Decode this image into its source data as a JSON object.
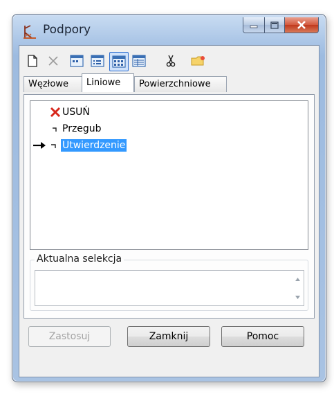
{
  "window": {
    "title": "Podpory",
    "icon": "supports-app-icon",
    "caption_buttons": [
      "minimize",
      "maximize",
      "close"
    ]
  },
  "toolbar": {
    "buttons": [
      {
        "icon": "new-file-icon"
      },
      {
        "icon": "delete-icon"
      },
      {
        "icon": "view-small-icons-icon"
      },
      {
        "icon": "view-list-icon"
      },
      {
        "icon": "view-large-icons-icon",
        "pressed": true
      },
      {
        "icon": "view-details-icon"
      },
      {
        "icon": "cut-icon"
      },
      {
        "icon": "folder-icon"
      }
    ]
  },
  "tabs": [
    {
      "label": "Węzłowe",
      "active": false
    },
    {
      "label": "Liniowe",
      "active": true
    },
    {
      "label": "Powierzchniowe",
      "active": false
    }
  ],
  "tree": {
    "items": [
      {
        "label": "USUŃ",
        "icon": "red-x-icon"
      },
      {
        "label": "Przegub",
        "icon": "hinge-support-icon"
      },
      {
        "label": "Utwierdzenie",
        "icon": "fixed-support-icon",
        "selected": true,
        "current_marker": "arrow-right-icon"
      }
    ]
  },
  "selection_group": {
    "title": "Aktualna selekcja",
    "value": ""
  },
  "buttons": {
    "apply": "Zastosuj",
    "close": "Zamknij",
    "help": "Pomoc"
  },
  "colors": {
    "selection": "#3399ff",
    "title_bar": "#aac5e6",
    "close_button": "#c0391d"
  }
}
